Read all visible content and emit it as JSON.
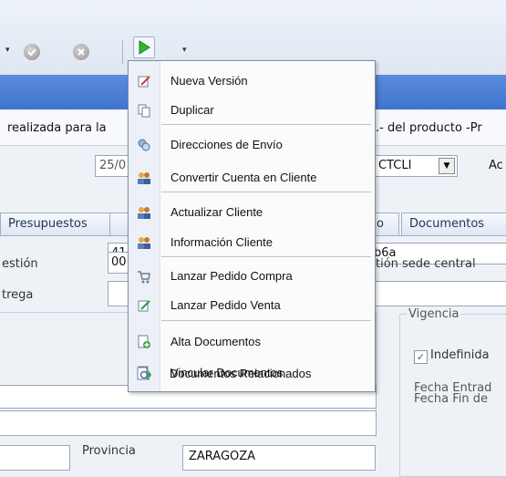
{
  "toolbar": {
    "icons": [
      "dropdown-arrow-icon",
      "checkmark-icon",
      "cancel-icon",
      "run-icon",
      "dropdown-arrow-icon"
    ]
  },
  "info_strip": {
    "left_text": "realizada para la",
    "right_text": ".- del producto -Pr"
  },
  "form": {
    "date_value": "25/0",
    "code_value": "CTCLI",
    "action_label": "Ac",
    "tabs": [
      "Presupuestos",
      "o",
      "Documentos"
    ],
    "field1_value": "41",
    "field2_value": "b6a",
    "gestion_label": "estión",
    "field3_value": "00",
    "sede_label": "tión sede central",
    "entrega_label": "trega",
    "vigencia_label": "Vigencia",
    "indefinida_label": "Indefinida",
    "fecha_entrada_label": "Fecha Entrad",
    "fecha_fin_label": "Fecha Fin de",
    "provincia_label": "Provincia",
    "provincia_value": "ZARAGOZA"
  },
  "menu": {
    "items": [
      {
        "label": "Nueva Versión",
        "icon": "edit-icon"
      },
      {
        "label": "Duplicar",
        "icon": "duplicate-icon"
      },
      {
        "label": "Direcciones de Envío",
        "icon": "addresses-icon"
      },
      {
        "label": "Convertir Cuenta en Cliente",
        "icon": "users-icon"
      },
      {
        "label": "Actualizar Cliente",
        "icon": "users-icon"
      },
      {
        "label": "Información Cliente",
        "icon": "users-icon"
      },
      {
        "label": "Lanzar Pedido Compra",
        "icon": "cart-icon"
      },
      {
        "label": "Lanzar Pedido Venta",
        "icon": "order-icon"
      },
      {
        "label": "Alta Documentos",
        "icon": "add-document-icon"
      },
      {
        "label": "Vincular Documentos",
        "icon": "link-document-icon"
      },
      {
        "label": "Documentos Relacionados",
        "icon": "related-documents-icon"
      }
    ]
  }
}
